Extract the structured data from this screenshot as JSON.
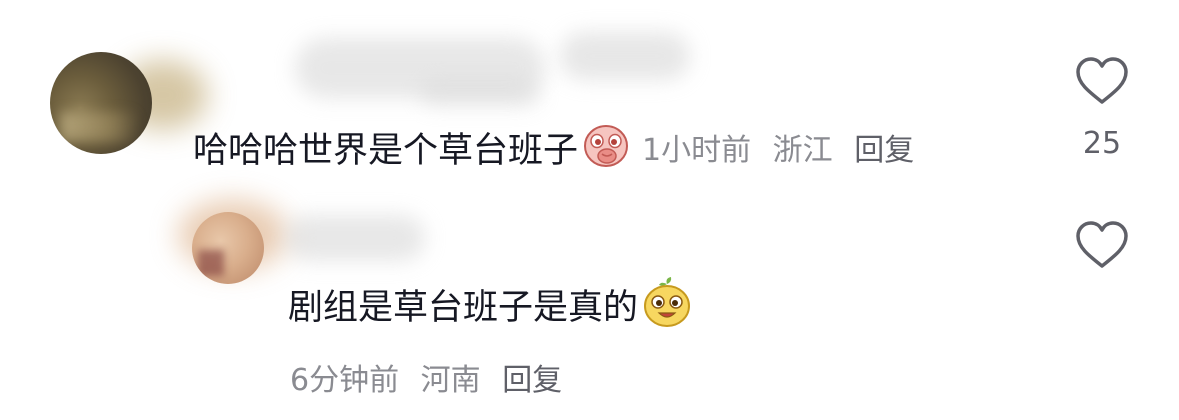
{
  "comments": [
    {
      "text": "哈哈哈世界是个草台班子",
      "emoji": "smirk-pig-emoji",
      "time": "1小时前",
      "location": "浙江",
      "reply_label": "回复",
      "like_count": "25"
    },
    {
      "text": "剧组是草台班子是真的",
      "emoji": "grinning-sprout-emoji",
      "time": "6分钟前",
      "location": "河南",
      "reply_label": "回复"
    }
  ],
  "icons": {
    "like": "heart-outline-icon"
  },
  "colors": {
    "text": "#161823",
    "meta": "#8a8b91",
    "icon_stroke": "#5f6068"
  }
}
